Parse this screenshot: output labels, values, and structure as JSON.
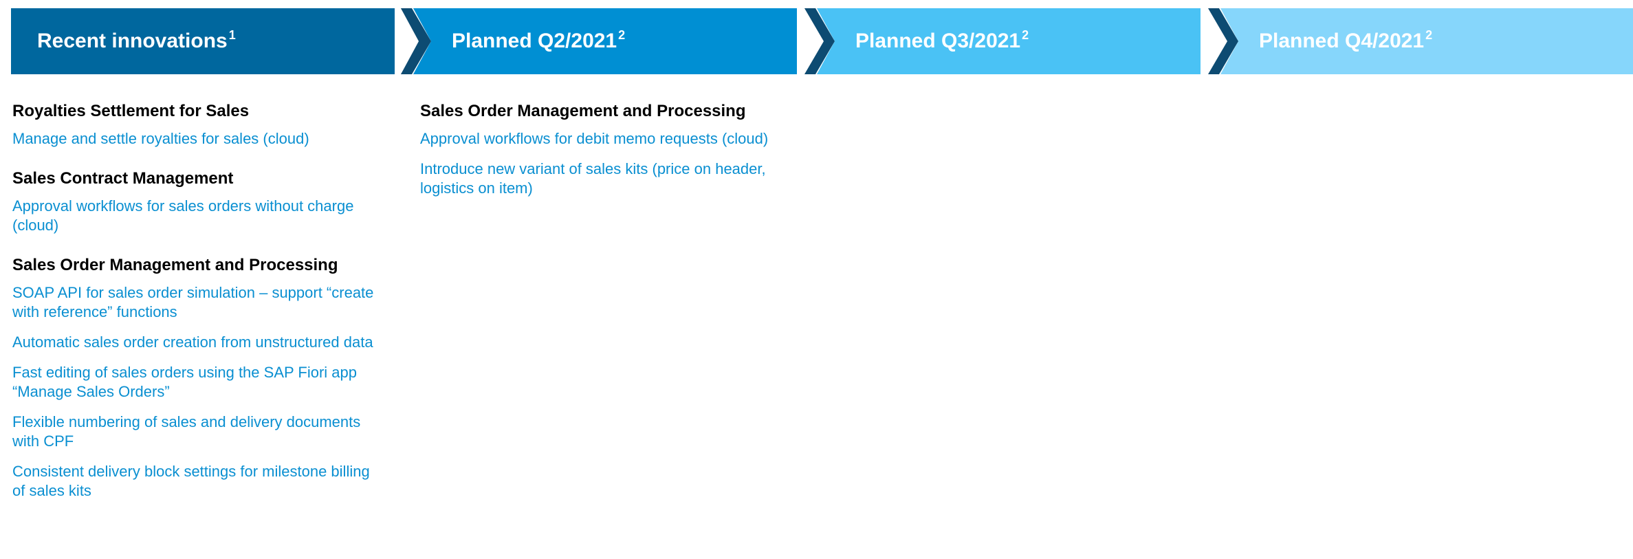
{
  "colors": {
    "phase_1": "#00679e",
    "phase_2": "#008fd3",
    "phase_3": "#4ac2f5",
    "phase_4": "#86d6fb",
    "chevron_shadow": "#0d4b72",
    "item_text": "#0a8fd1",
    "title_text": "#000000"
  },
  "phases": [
    {
      "label": "Recent innovations",
      "sup": "1"
    },
    {
      "label": "Planned Q2/2021",
      "sup": "2"
    },
    {
      "label": "Planned Q3/2021",
      "sup": "2"
    },
    {
      "label": "Planned Q4/2021",
      "sup": "2"
    }
  ],
  "recent": {
    "groups": [
      {
        "title": "Royalties Settlement for Sales",
        "items": [
          "Manage and settle royalties for sales (cloud)"
        ]
      },
      {
        "title": "Sales Contract Management",
        "items": [
          "Approval workflows for sales orders without charge (cloud)"
        ]
      },
      {
        "title": "Sales Order Management and Processing",
        "items": [
          "SOAP API for sales order simulation – support “create with reference” functions",
          "Automatic sales order creation from unstructured data",
          "Fast editing of sales orders using the SAP Fiori app “Manage Sales Orders”",
          "Flexible numbering of sales and delivery documents with CPF",
          "Consistent delivery block settings for milestone billing of sales kits"
        ]
      }
    ]
  },
  "planned_q2": {
    "groups": [
      {
        "title": "Sales Order Management and Processing",
        "items": [
          "Approval workflows for debit memo requests (cloud)",
          "Introduce new variant of sales kits (price on header, logistics on item)"
        ]
      }
    ]
  }
}
